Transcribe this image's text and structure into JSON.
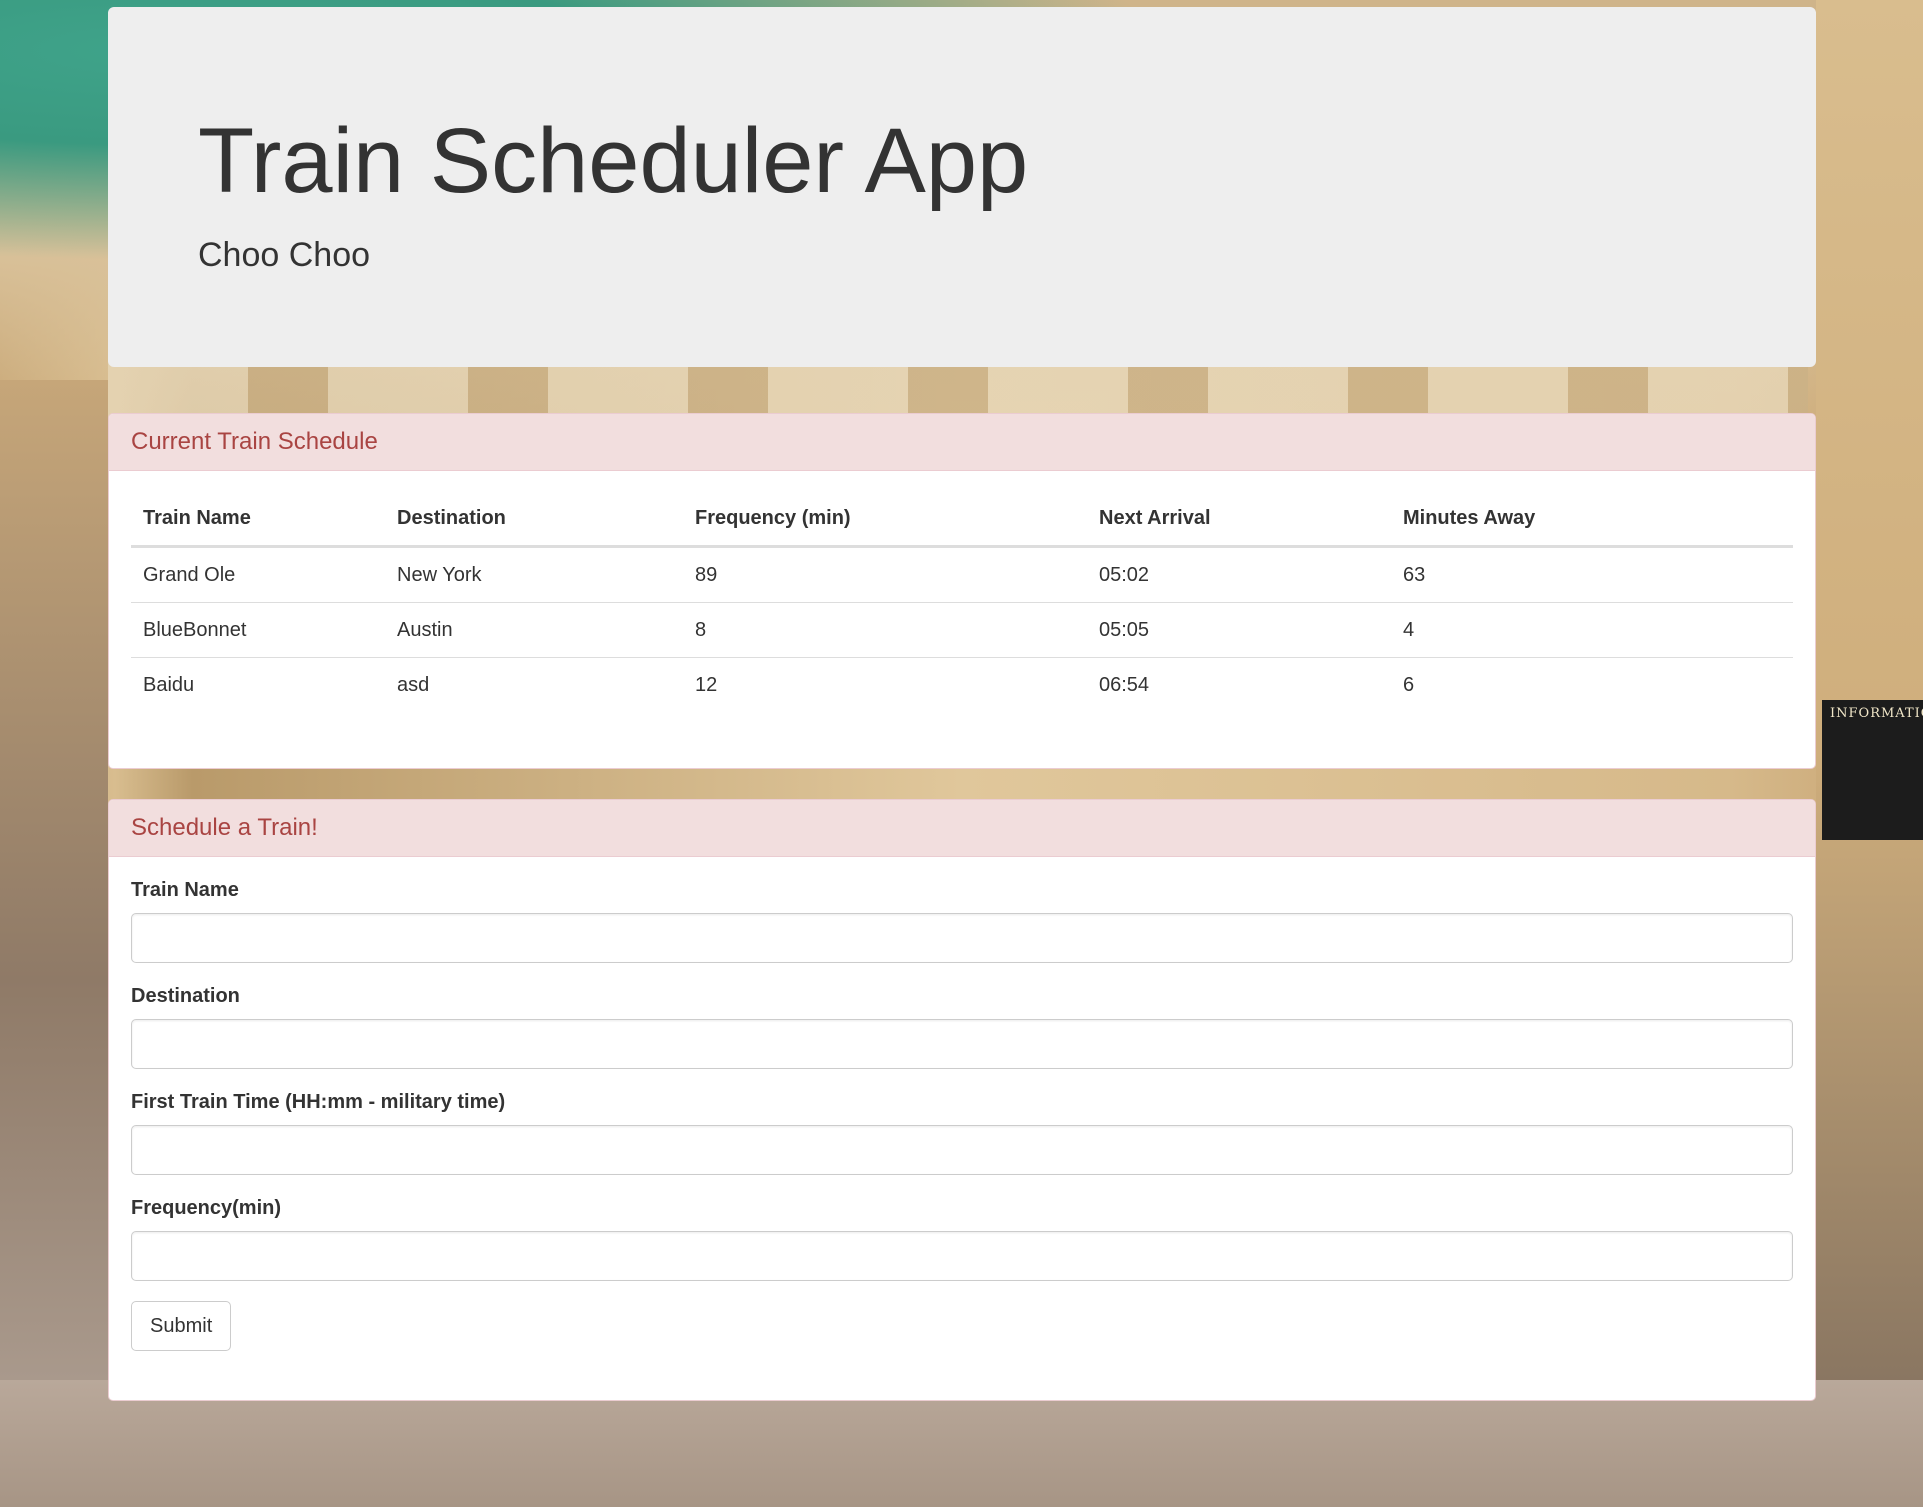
{
  "header": {
    "title": "Train Scheduler App",
    "subtitle": "Choo Choo"
  },
  "background": {
    "info_board_text": "INFORMATION"
  },
  "schedule_panel": {
    "heading": "Current Train Schedule",
    "columns": [
      "Train Name",
      "Destination",
      "Frequency (min)",
      "Next Arrival",
      "Minutes Away"
    ],
    "rows": [
      [
        "Grand Ole",
        "New York",
        "89",
        "05:02",
        "63"
      ],
      [
        "BlueBonnet",
        "Austin",
        "8",
        "05:05",
        "4"
      ],
      [
        "Baidu",
        "asd",
        "12",
        "06:54",
        "6"
      ]
    ]
  },
  "form_panel": {
    "heading": "Schedule a Train!",
    "fields": {
      "train_name": {
        "label": "Train Name",
        "value": ""
      },
      "destination": {
        "label": "Destination",
        "value": ""
      },
      "first_train_time": {
        "label": "First Train Time (HH:mm - military time)",
        "value": ""
      },
      "frequency": {
        "label": "Frequency(min)",
        "value": ""
      }
    },
    "submit_label": "Submit"
  },
  "colors": {
    "panel_heading_bg": "#f2dede",
    "panel_heading_text": "#a94442",
    "jumbotron_bg": "#eeeeee"
  }
}
